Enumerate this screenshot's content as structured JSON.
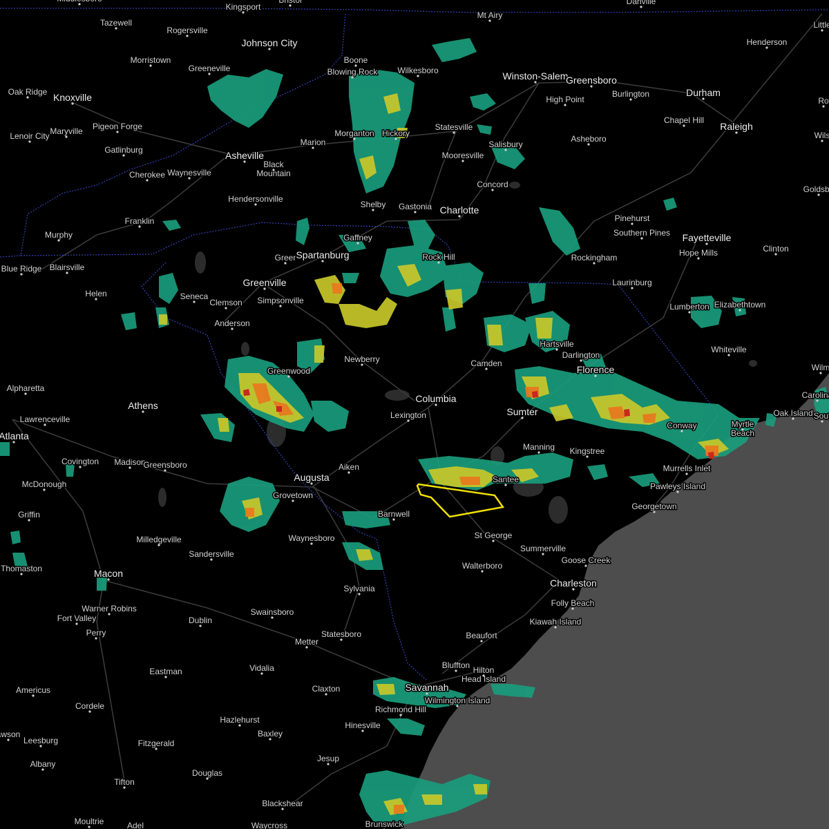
{
  "map": {
    "colors": {
      "land": "#000000",
      "ocean": "#4d4d4d",
      "state_border": "#2f3fa8",
      "roads": "#3c3c3c",
      "water": "#2c2c2c",
      "radar_light": "#1a9c7c",
      "radar_mid": "#c8c82a",
      "radar_high": "#e8781e",
      "radar_extreme": "#c8281e",
      "warning_polygon": "#f0e000"
    },
    "labels": [
      {
        "id": "kingsport",
        "text": "Kingsport"
      },
      {
        "id": "bristol",
        "text": "Bristol"
      },
      {
        "id": "danville",
        "text": "Danville"
      },
      {
        "id": "middlesboro",
        "text": "Middlesboro"
      },
      {
        "id": "tazewell",
        "text": "Tazewell"
      },
      {
        "id": "rogersville",
        "text": "Rogersville"
      },
      {
        "id": "johnson-city",
        "text": "Johnson City"
      },
      {
        "id": "mt-airy",
        "text": "Mt Airy"
      },
      {
        "id": "henderson",
        "text": "Henderson"
      },
      {
        "id": "little",
        "text": "Little"
      },
      {
        "id": "morristown-tn",
        "text": "Morristown"
      },
      {
        "id": "greeneville",
        "text": "Greeneville"
      },
      {
        "id": "boone",
        "text": "Boone"
      },
      {
        "id": "blowing-rock",
        "text": "Blowing Rock"
      },
      {
        "id": "wilkesboro",
        "text": "Wilkesboro"
      },
      {
        "id": "winston-salem",
        "text": "Winston-Salem"
      },
      {
        "id": "greensboro-nc",
        "text": "Greensboro"
      },
      {
        "id": "oak-ridge",
        "text": "Oak Ridge"
      },
      {
        "id": "knoxville",
        "text": "Knoxville"
      },
      {
        "id": "high-point",
        "text": "High Point"
      },
      {
        "id": "burlington",
        "text": "Burlington"
      },
      {
        "id": "durham",
        "text": "Durham"
      },
      {
        "id": "rocky-mount",
        "text": "Ro"
      },
      {
        "id": "pigeon-forge",
        "text": "Pigeon Forge"
      },
      {
        "id": "maryville",
        "text": "Maryville"
      },
      {
        "id": "lenoir-city",
        "text": "Lenoir City"
      },
      {
        "id": "chapel-hill",
        "text": "Chapel Hill"
      },
      {
        "id": "raleigh",
        "text": "Raleigh"
      },
      {
        "id": "statesville",
        "text": "Statesville"
      },
      {
        "id": "morganton",
        "text": "Morganton"
      },
      {
        "id": "hickory",
        "text": "Hickory"
      },
      {
        "id": "marion",
        "text": "Marion"
      },
      {
        "id": "gatlinburg",
        "text": "Gatlinburg"
      },
      {
        "id": "asheboro",
        "text": "Asheboro"
      },
      {
        "id": "wilson",
        "text": "Wils"
      },
      {
        "id": "salisbury",
        "text": "Salisbury"
      },
      {
        "id": "mooresville",
        "text": "Mooresville"
      },
      {
        "id": "asheville",
        "text": "Asheville"
      },
      {
        "id": "black-mountain",
        "text": "Black\nMountain"
      },
      {
        "id": "cherokee",
        "text": "Cherokee"
      },
      {
        "id": "waynesville",
        "text": "Waynesville"
      },
      {
        "id": "concord",
        "text": "Concord"
      },
      {
        "id": "goldsboro",
        "text": "Goldsbo"
      },
      {
        "id": "shelby",
        "text": "Shelby"
      },
      {
        "id": "gastonia",
        "text": "Gastonia"
      },
      {
        "id": "charlotte",
        "text": "Charlotte"
      },
      {
        "id": "hendersonville",
        "text": "Hendersonville"
      },
      {
        "id": "franklin",
        "text": "Franklin"
      },
      {
        "id": "pinehurst",
        "text": "Pinehurst"
      },
      {
        "id": "southern-pines",
        "text": "Southern Pines"
      },
      {
        "id": "fayetteville",
        "text": "Fayetteville"
      },
      {
        "id": "murphy",
        "text": "Murphy"
      },
      {
        "id": "gaffney",
        "text": "Gaffney"
      },
      {
        "id": "hope-mills",
        "text": "Hope Mills"
      },
      {
        "id": "clinton",
        "text": "Clinton"
      },
      {
        "id": "blue-ridge",
        "text": "Blue Ridge"
      },
      {
        "id": "blairsville",
        "text": "Blairsville"
      },
      {
        "id": "greer",
        "text": "Greer"
      },
      {
        "id": "spartanburg",
        "text": "Spartanburg"
      },
      {
        "id": "rock-hill",
        "text": "Rock Hill"
      },
      {
        "id": "rockingham",
        "text": "Rockingham"
      },
      {
        "id": "laurinburg",
        "text": "Laurinburg"
      },
      {
        "id": "greenville",
        "text": "Greenville"
      },
      {
        "id": "helen",
        "text": "Helen"
      },
      {
        "id": "seneca",
        "text": "Seneca"
      },
      {
        "id": "clemson",
        "text": "Clemson"
      },
      {
        "id": "simpsonville",
        "text": "Simpsonville"
      },
      {
        "id": "lumberton",
        "text": "Lumberton"
      },
      {
        "id": "elizabethtown",
        "text": "Elizabethtown"
      },
      {
        "id": "anderson",
        "text": "Anderson"
      },
      {
        "id": "hartsville",
        "text": "Hartsville"
      },
      {
        "id": "darlington",
        "text": "Darlington"
      },
      {
        "id": "whiteville",
        "text": "Whiteville"
      },
      {
        "id": "newberry",
        "text": "Newberry"
      },
      {
        "id": "camden",
        "text": "Camden"
      },
      {
        "id": "greenwood",
        "text": "Greenwood"
      },
      {
        "id": "florence",
        "text": "Florence"
      },
      {
        "id": "wilmington",
        "text": "Wilm"
      },
      {
        "id": "alpharetta",
        "text": "Alpharetta"
      },
      {
        "id": "columbia",
        "text": "Columbia"
      },
      {
        "id": "carolina-beach",
        "text": "Carolina"
      },
      {
        "id": "lawrenceville",
        "text": "Lawrenceville"
      },
      {
        "id": "athens",
        "text": "Athens"
      },
      {
        "id": "lexington",
        "text": "Lexington"
      },
      {
        "id": "sumter",
        "text": "Sumter"
      },
      {
        "id": "oak-island",
        "text": "Oak Island"
      },
      {
        "id": "southport",
        "text": "Sout"
      },
      {
        "id": "conway",
        "text": "Conway"
      },
      {
        "id": "myrtle-beach",
        "text": "Myrtle\nBeach"
      },
      {
        "id": "atlanta",
        "text": "Atlanta"
      },
      {
        "id": "manning",
        "text": "Manning"
      },
      {
        "id": "kingstree",
        "text": "Kingstree"
      },
      {
        "id": "covington",
        "text": "Covington"
      },
      {
        "id": "madison",
        "text": "Madison"
      },
      {
        "id": "greensboro-ga",
        "text": "Greensboro"
      },
      {
        "id": "aiken",
        "text": "Aiken"
      },
      {
        "id": "augusta",
        "text": "Augusta"
      },
      {
        "id": "mcdonough",
        "text": "McDonough"
      },
      {
        "id": "murrells-inlet",
        "text": "Murrells Inlet"
      },
      {
        "id": "santee",
        "text": "Santee"
      },
      {
        "id": "grovetown",
        "text": "Grovetown"
      },
      {
        "id": "pawleys-island",
        "text": "Pawleys Island"
      },
      {
        "id": "griffin",
        "text": "Griffin"
      },
      {
        "id": "georgetown",
        "text": "Georgetown"
      },
      {
        "id": "barnwell",
        "text": "Barnwell"
      },
      {
        "id": "st-george",
        "text": "St George"
      },
      {
        "id": "milledgeville",
        "text": "Milledgeville"
      },
      {
        "id": "waynesboro",
        "text": "Waynesboro"
      },
      {
        "id": "summerville",
        "text": "Summerville"
      },
      {
        "id": "sandersville",
        "text": "Sandersville"
      },
      {
        "id": "goose-creek",
        "text": "Goose Creek"
      },
      {
        "id": "walterboro",
        "text": "Walterboro"
      },
      {
        "id": "thomaston",
        "text": "Thomaston"
      },
      {
        "id": "macon",
        "text": "Macon"
      },
      {
        "id": "charleston",
        "text": "Charleston"
      },
      {
        "id": "sylvania",
        "text": "Sylvania"
      },
      {
        "id": "folly-beach",
        "text": "Folly Beach"
      },
      {
        "id": "warner-robins",
        "text": "Warner Robins"
      },
      {
        "id": "swainsboro",
        "text": "Swainsboro"
      },
      {
        "id": "fort-valley",
        "text": "Fort Valley"
      },
      {
        "id": "dublin",
        "text": "Dublin"
      },
      {
        "id": "kiawah-island",
        "text": "Kiawah Island"
      },
      {
        "id": "perry",
        "text": "Perry"
      },
      {
        "id": "statesboro",
        "text": "Statesboro"
      },
      {
        "id": "beaufort",
        "text": "Beaufort"
      },
      {
        "id": "metter",
        "text": "Metter"
      },
      {
        "id": "bluffton",
        "text": "Bluffton"
      },
      {
        "id": "vidalia",
        "text": "Vidalia"
      },
      {
        "id": "hilton-head",
        "text": "Hilton\nHead Island"
      },
      {
        "id": "eastman",
        "text": "Eastman"
      },
      {
        "id": "claxton",
        "text": "Claxton"
      },
      {
        "id": "savannah",
        "text": "Savannah"
      },
      {
        "id": "americus",
        "text": "Americus"
      },
      {
        "id": "cordele",
        "text": "Cordele"
      },
      {
        "id": "wilmington-island",
        "text": "Wilmington Island"
      },
      {
        "id": "richmond-hill",
        "text": "Richmond Hill"
      },
      {
        "id": "hazlehurst",
        "text": "Hazlehurst"
      },
      {
        "id": "hinesville",
        "text": "Hinesville"
      },
      {
        "id": "baxley",
        "text": "Baxley"
      },
      {
        "id": "dawson",
        "text": "awson"
      },
      {
        "id": "leesburg",
        "text": "Leesburg"
      },
      {
        "id": "fitzgerald",
        "text": "Fitzgerald"
      },
      {
        "id": "albany",
        "text": "Albany"
      },
      {
        "id": "jesup",
        "text": "Jesup"
      },
      {
        "id": "douglas",
        "text": "Douglas"
      },
      {
        "id": "tifton",
        "text": "Tifton"
      },
      {
        "id": "blackshear",
        "text": "Blackshear"
      },
      {
        "id": "moultrie",
        "text": "Moultrie"
      },
      {
        "id": "adel",
        "text": "Adel"
      },
      {
        "id": "brunswick",
        "text": "Brunswick"
      },
      {
        "id": "waycross",
        "text": "Waycross"
      }
    ]
  }
}
